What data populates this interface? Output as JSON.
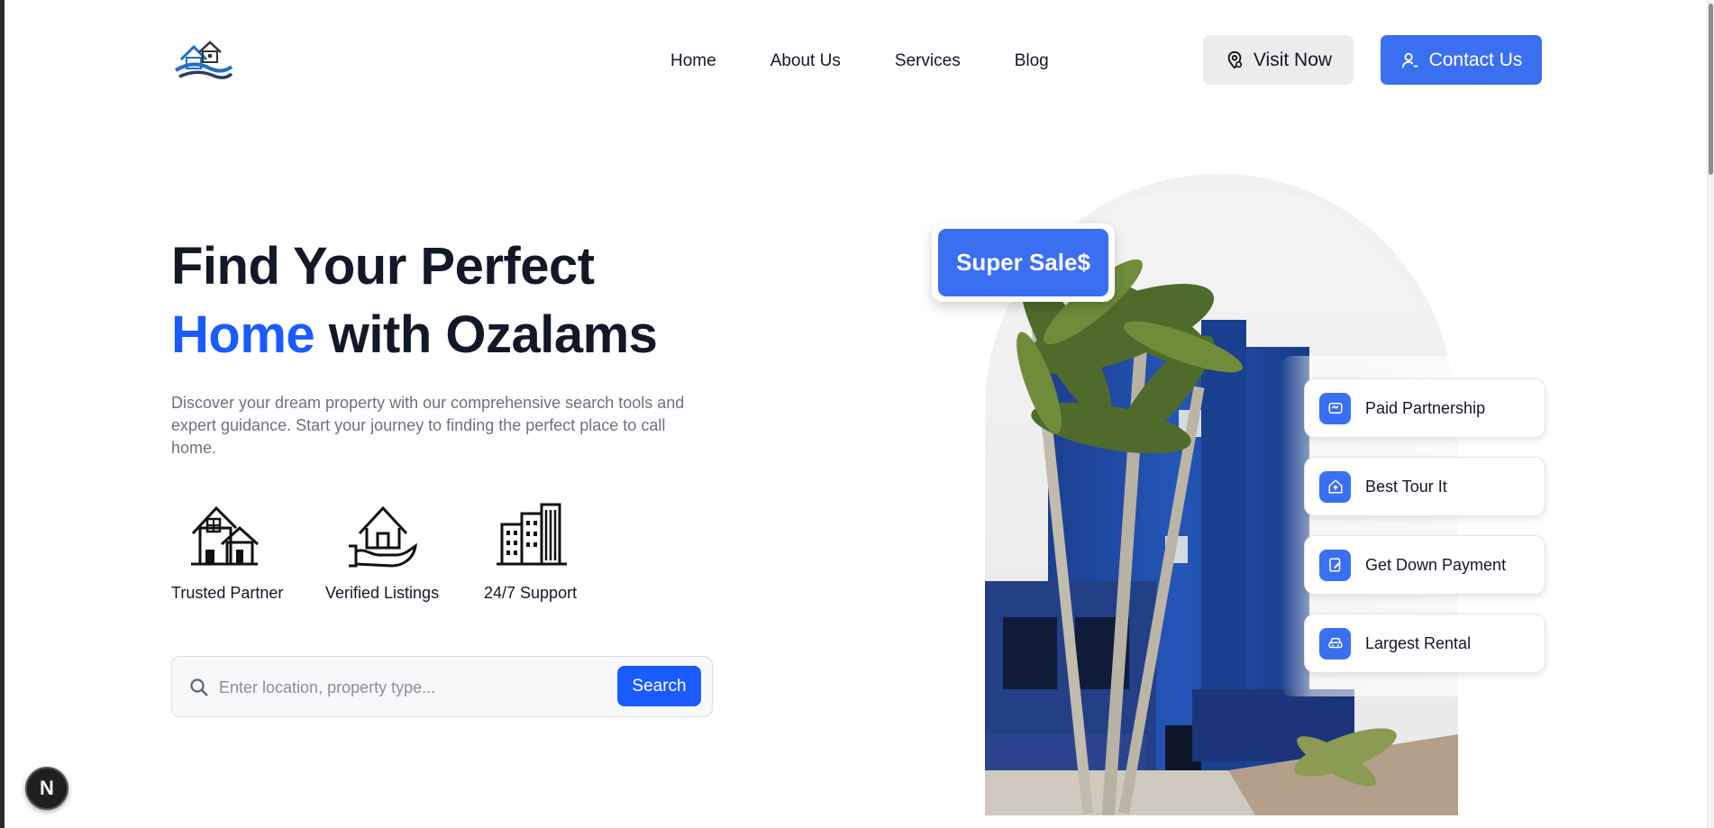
{
  "brand": {
    "logo_icon": "house-logo-icon",
    "primary_color": "#1a5bff",
    "accent_color": "#3b6ff2"
  },
  "nav": {
    "items": [
      {
        "label": "Home"
      },
      {
        "label": "About Us"
      },
      {
        "label": "Services"
      },
      {
        "label": "Blog"
      }
    ]
  },
  "header": {
    "visit_label": "Visit Now",
    "visit_icon": "location-pin-icon",
    "contact_label": "Contact Us",
    "contact_icon": "user-icon"
  },
  "hero": {
    "title_line1": "Find Your Perfect",
    "title_accent": "Home",
    "title_rest": " with Ozalams",
    "description": "Discover your dream property with our comprehensive search tools and expert guidance. Start your journey to finding the perfect place to call home."
  },
  "features": [
    {
      "label": "Trusted Partner",
      "icon": "houses-icon"
    },
    {
      "label": "Verified Listings",
      "icon": "house-in-hand-icon"
    },
    {
      "label": "24/7 Support",
      "icon": "buildings-icon"
    }
  ],
  "search": {
    "placeholder": "Enter location, property type...",
    "value": "",
    "button_label": "Search"
  },
  "sale_badge": {
    "label": "Super Sale$"
  },
  "perks": [
    {
      "label": "Paid Partnership",
      "icon": "handshake-icon"
    },
    {
      "label": "Best Tour It",
      "icon": "home-upload-icon"
    },
    {
      "label": "Get Down Payment",
      "icon": "edit-document-icon"
    },
    {
      "label": "Largest Rental",
      "icon": "car-icon"
    }
  ],
  "dev_badge": {
    "label": "N"
  }
}
